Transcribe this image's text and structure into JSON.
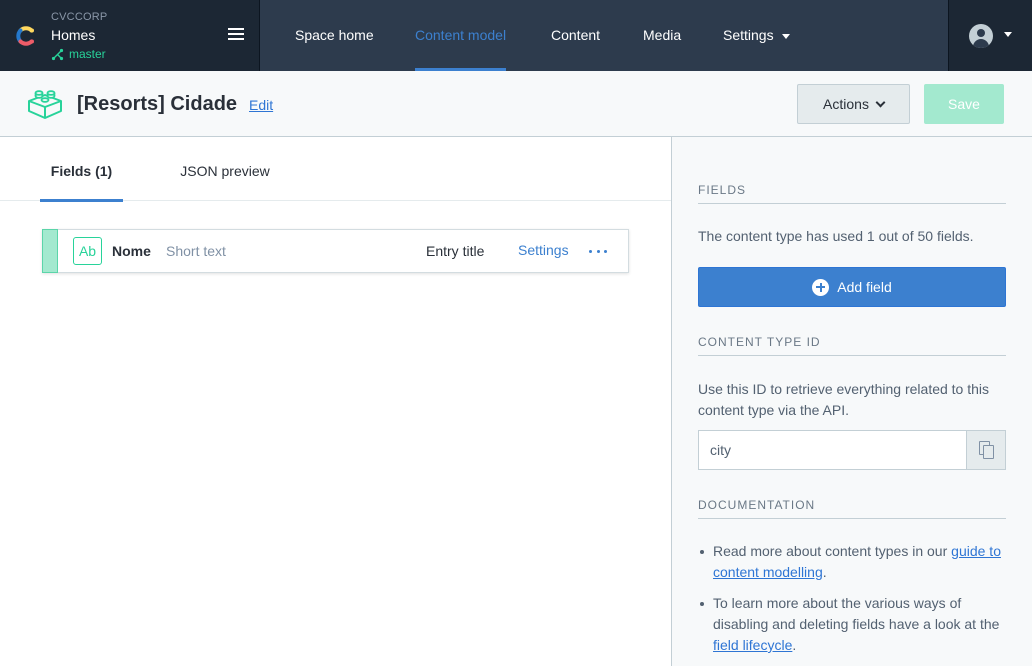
{
  "topnav": {
    "org": "CVCCORP",
    "space": "Homes",
    "environment": "master",
    "menu_icon": "hamburger-icon",
    "items": [
      {
        "label": "Space home",
        "active": false
      },
      {
        "label": "Content model",
        "active": true
      },
      {
        "label": "Content",
        "active": false
      },
      {
        "label": "Media",
        "active": false
      },
      {
        "label": "Settings",
        "active": false,
        "has_dropdown": true
      }
    ],
    "accent": "#3c80cf",
    "env_color": "#28d39a"
  },
  "header": {
    "title": "[Resorts] Cidade",
    "edit_label": "Edit",
    "actions_label": "Actions",
    "save_label": "Save",
    "save_disabled": true
  },
  "tabs": [
    {
      "label": "Fields (1)",
      "active": true
    },
    {
      "label": "JSON preview",
      "active": false
    }
  ],
  "fields": [
    {
      "icon_text": "Ab",
      "name": "Nome",
      "type": "Short text",
      "badge": "Entry title",
      "settings_label": "Settings"
    }
  ],
  "sidebar": {
    "fields_heading": "FIELDS",
    "fields_usage": "The content type has used 1 out of 50 fields.",
    "add_field_label": "Add field",
    "content_type_id_heading": "CONTENT TYPE ID",
    "content_type_id_desc": "Use this ID to retrieve everything related to this content type via the API.",
    "content_type_id": "city",
    "documentation_heading": "DOCUMENTATION",
    "doc1_before": "Read more about content types in our ",
    "doc1_link": "guide to content modelling",
    "doc1_after": ".",
    "doc2_before": "To learn more about the various ways of disabling and deleting fields have a look at the ",
    "doc2_link": "field lifecycle",
    "doc2_after": "."
  }
}
